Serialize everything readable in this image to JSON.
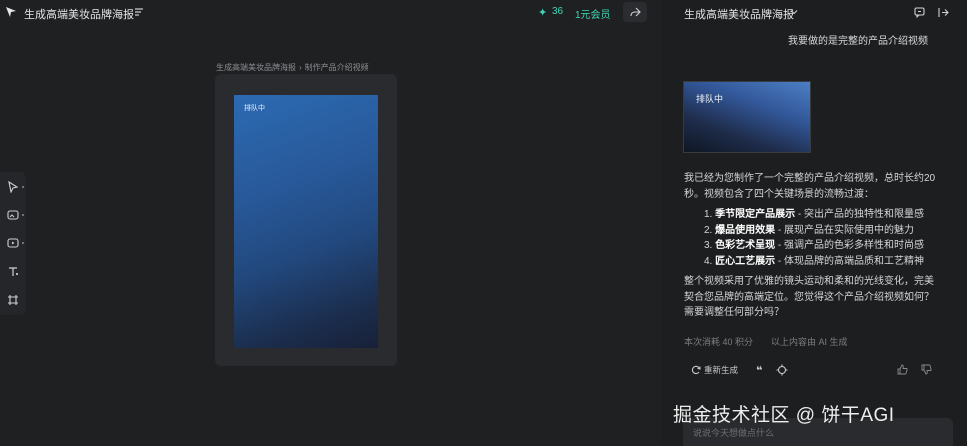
{
  "topbar": {
    "project_title": "生成高端美妆品牌海报",
    "credits_icon": "sparkle-icon",
    "credits": "36",
    "member_link": "1元会员",
    "share_icon": "share-icon"
  },
  "canvas": {
    "breadcrumb": [
      "生成高端美妆品牌海报",
      "制作产品介绍视频"
    ],
    "breadcrumb_separator": "›",
    "preview_status": "排队中"
  },
  "tools": [
    "cursor-icon",
    "image-gen-icon",
    "video-gen-icon",
    "text-tool-icon",
    "frame-tool-icon"
  ],
  "chat": {
    "title": "生成高端美妆品牌海报",
    "user_message": "我要做的是完整的产品介绍视频",
    "queue_card_label": "排队中",
    "reply_intro": "我已经为您制作了一个完整的产品介绍视频，总时长约20秒。视频包含了四个关键场景的流畅过渡：",
    "reply_items": [
      {
        "num": "1.",
        "title": "季节限定产品展示",
        "desc": " - 突出产品的独特性和限量感"
      },
      {
        "num": "2.",
        "title": "爆品使用效果",
        "desc": " - 展现产品在实际使用中的魅力"
      },
      {
        "num": "3.",
        "title": "色彩艺术呈现",
        "desc": " - 强调产品的色彩多样性和时尚感"
      },
      {
        "num": "4.",
        "title": "匠心工艺展示",
        "desc": " - 体现品牌的高端品质和工艺精神"
      }
    ],
    "reply_summary": "整个视频采用了优雅的镜头运动和柔和的光线变化，完美契合您品牌的高端定位。您觉得这个产品介绍视频如何？需要调整任何部分吗？",
    "meta_cost": "本次消耗 40 积分",
    "meta_ai": "以上内容由 AI 生成",
    "regenerate_label": "重新生成",
    "quote_label": "❝",
    "input_placeholder": "说说今天想做点什么"
  },
  "watermark": "掘金技术社区 @ 饼干AGI",
  "colors": {
    "accent": "#3fd6b6",
    "background": "#1e1f21",
    "preview_blue": "#2c6ab2"
  }
}
